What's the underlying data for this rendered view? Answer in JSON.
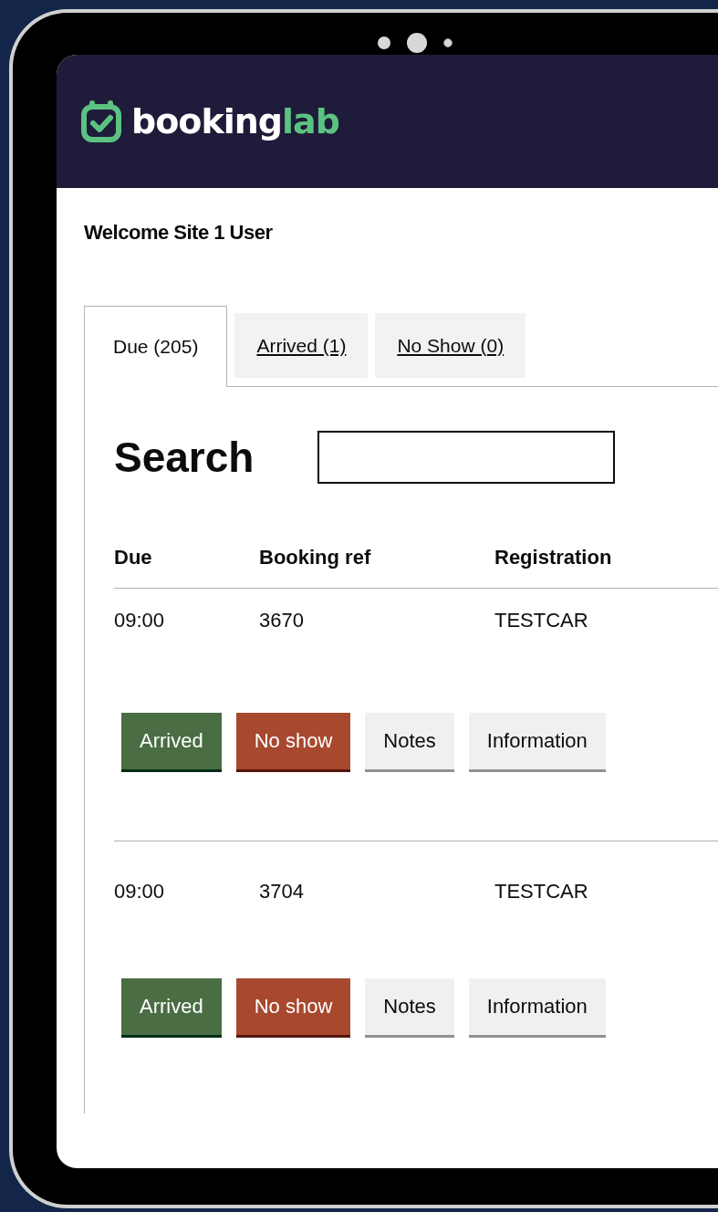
{
  "logo": {
    "text": "booking",
    "accent": "lab"
  },
  "welcome": "Welcome Site 1 User",
  "tabs": [
    {
      "label": "Due (205)",
      "selected": true
    },
    {
      "label": "Arrived (1)",
      "selected": false
    },
    {
      "label": "No Show (0)",
      "selected": false
    }
  ],
  "search": {
    "label": "Search"
  },
  "table": {
    "columns": [
      "Due",
      "Booking ref",
      "Registration"
    ],
    "rows": [
      {
        "cells": [
          "09:00",
          "3670",
          "TESTCAR"
        ],
        "actions": [
          {
            "kind": "arrived",
            "label": "Arrived"
          },
          {
            "kind": "no_show",
            "label": "No show"
          },
          {
            "kind": "notes",
            "label": "Notes"
          },
          {
            "kind": "information",
            "label": "Information"
          }
        ]
      },
      {
        "cells": [
          "09:00",
          "3704",
          "TESTCAR"
        ],
        "actions": [
          {
            "kind": "arrived",
            "label": "Arrived"
          },
          {
            "kind": "no_show",
            "label": "No show"
          },
          {
            "kind": "notes",
            "label": "Notes"
          },
          {
            "kind": "information",
            "label": "Information"
          }
        ]
      }
    ]
  }
}
